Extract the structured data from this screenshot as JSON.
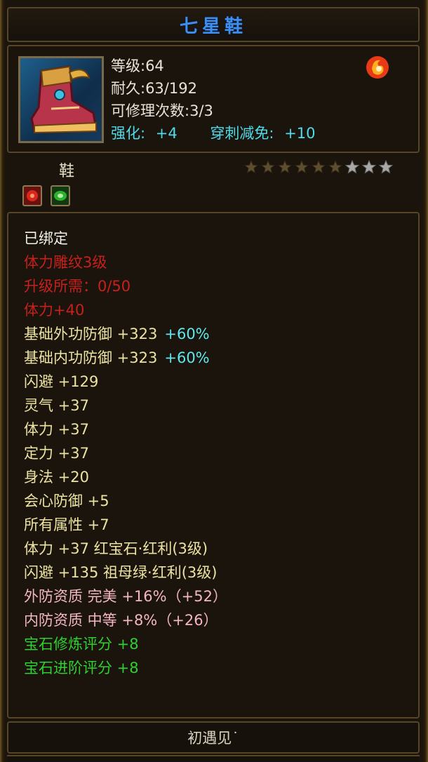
{
  "item": {
    "name": "七星鞋",
    "level": "等级:64",
    "durability": "耐久:63/192",
    "repair_count": "可修理次数:3/3",
    "enhance_label": "强化:",
    "enhance_value": "+4",
    "pierce_label": "穿刺减免:",
    "pierce_value": "+10",
    "type": "鞋",
    "stars_filled": 6,
    "stars_total": 9,
    "icon": "boot-icon",
    "badge_icon": "fire-emblem-icon"
  },
  "gem_slots": [
    {
      "icon": "red-gem-slot-icon",
      "color": "#d8281c"
    },
    {
      "icon": "green-gem-slot-icon",
      "color": "#2fb030"
    }
  ],
  "attributes": [
    {
      "text": "已绑定",
      "style": "white"
    },
    {
      "text": "体力雕纹3级",
      "style": "red"
    },
    {
      "text": "升级所需：0/50",
      "style": "red"
    },
    {
      "text": "体力+40",
      "style": "red"
    },
    {
      "text": "基础外功防御 +323",
      "extra": "+60%",
      "style": "yellow"
    },
    {
      "text": "基础内功防御 +323",
      "extra": "+60%",
      "style": "yellow"
    },
    {
      "text": "闪避 +129",
      "style": "yellow"
    },
    {
      "text": "灵气 +37",
      "style": "yellow"
    },
    {
      "text": "体力 +37",
      "style": "yellow"
    },
    {
      "text": "定力 +37",
      "style": "yellow"
    },
    {
      "text": "身法 +20",
      "style": "yellow"
    },
    {
      "text": "会心防御 +5",
      "style": "yellow"
    },
    {
      "text": "所有属性 +7",
      "style": "yellow"
    },
    {
      "text": "体力 +37 红宝石·红利(3级)",
      "style": "yellow"
    },
    {
      "text": "闪避 +135 祖母绿·红利(3级)",
      "style": "yellow"
    },
    {
      "text": "外防资质  完美 +16%（+52）",
      "style": "pink"
    },
    {
      "text": "内防资质  中等 +8%（+26）",
      "style": "pink"
    },
    {
      "text": "宝石修炼评分 +8",
      "style": "green"
    },
    {
      "text": "宝石进阶评分 +8",
      "style": "green"
    }
  ],
  "footer": {
    "text": "初遇见˙"
  },
  "colors": {
    "title": "#3c8ff0",
    "white": "#f2f0ea",
    "red": "#c8201c",
    "yellow": "#ede3a0",
    "cyan": "#5fe8f0",
    "pink": "#f4b6c4",
    "green": "#2fd02f",
    "border": "#574528"
  }
}
